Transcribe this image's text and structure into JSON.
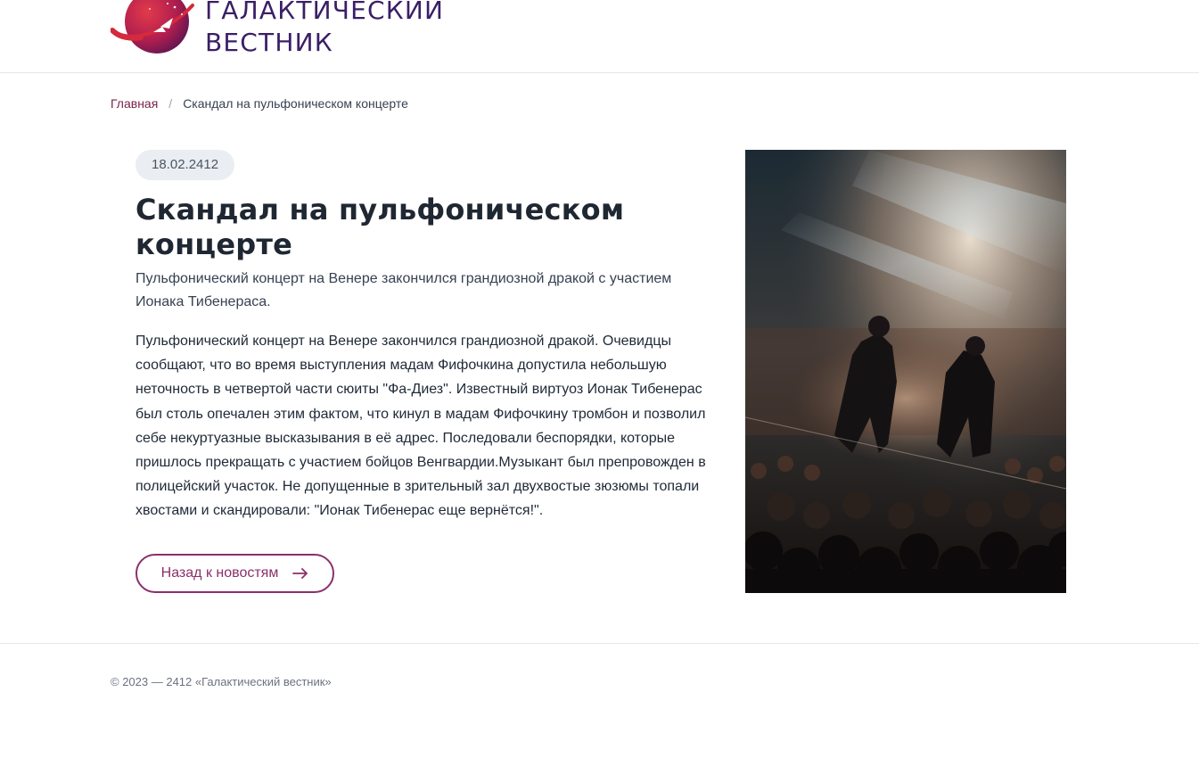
{
  "site": {
    "name_line1": "ГАЛАКТИЧЕСКИЙ",
    "name_line2": "ВЕСТНИК",
    "logo_icon": "rocket-planet-icon",
    "brand_color": "#8b2f6b"
  },
  "breadcrumb": {
    "home": "Главная",
    "separator": "/",
    "current": "Скандал на пульфоническом концерте"
  },
  "article": {
    "date": "18.02.2412",
    "title": "Скандал на пульфоническом концерте",
    "lead": "Пульфонический концерт на Венере закончился грандиозной дракой с участием Ионака Тибенераса.",
    "body": "Пульфонический концерт на Венере закончился грандиозной дракой. Очевидцы сообщают, что во время выступления мадам Фифочкина допустила небольшую неточность в четвертой части сюиты \"Фа-Диез\". Известный виртуоз Ионак Тибенерас был столь опечален этим фактом, что кинул в мадам Фифочкину тромбон и позволил себе некуртуазные высказывания в её адрес. Последовали беспорядки, которые пришлось прекращать с участием бойцов Венгвардии.Музыкант был препровожден в полицейский участок. Не допущенные в зрительный зал двухвостые зюзюмы топали хвостами и скандировали: \"Ионак Тибенерас еще вернётся!\".",
    "back_button": "Назад к новостям",
    "back_icon": "arrow-right-icon"
  },
  "footer": {
    "copyright": "© 2023 — 2412 «Галактический вестник»"
  }
}
